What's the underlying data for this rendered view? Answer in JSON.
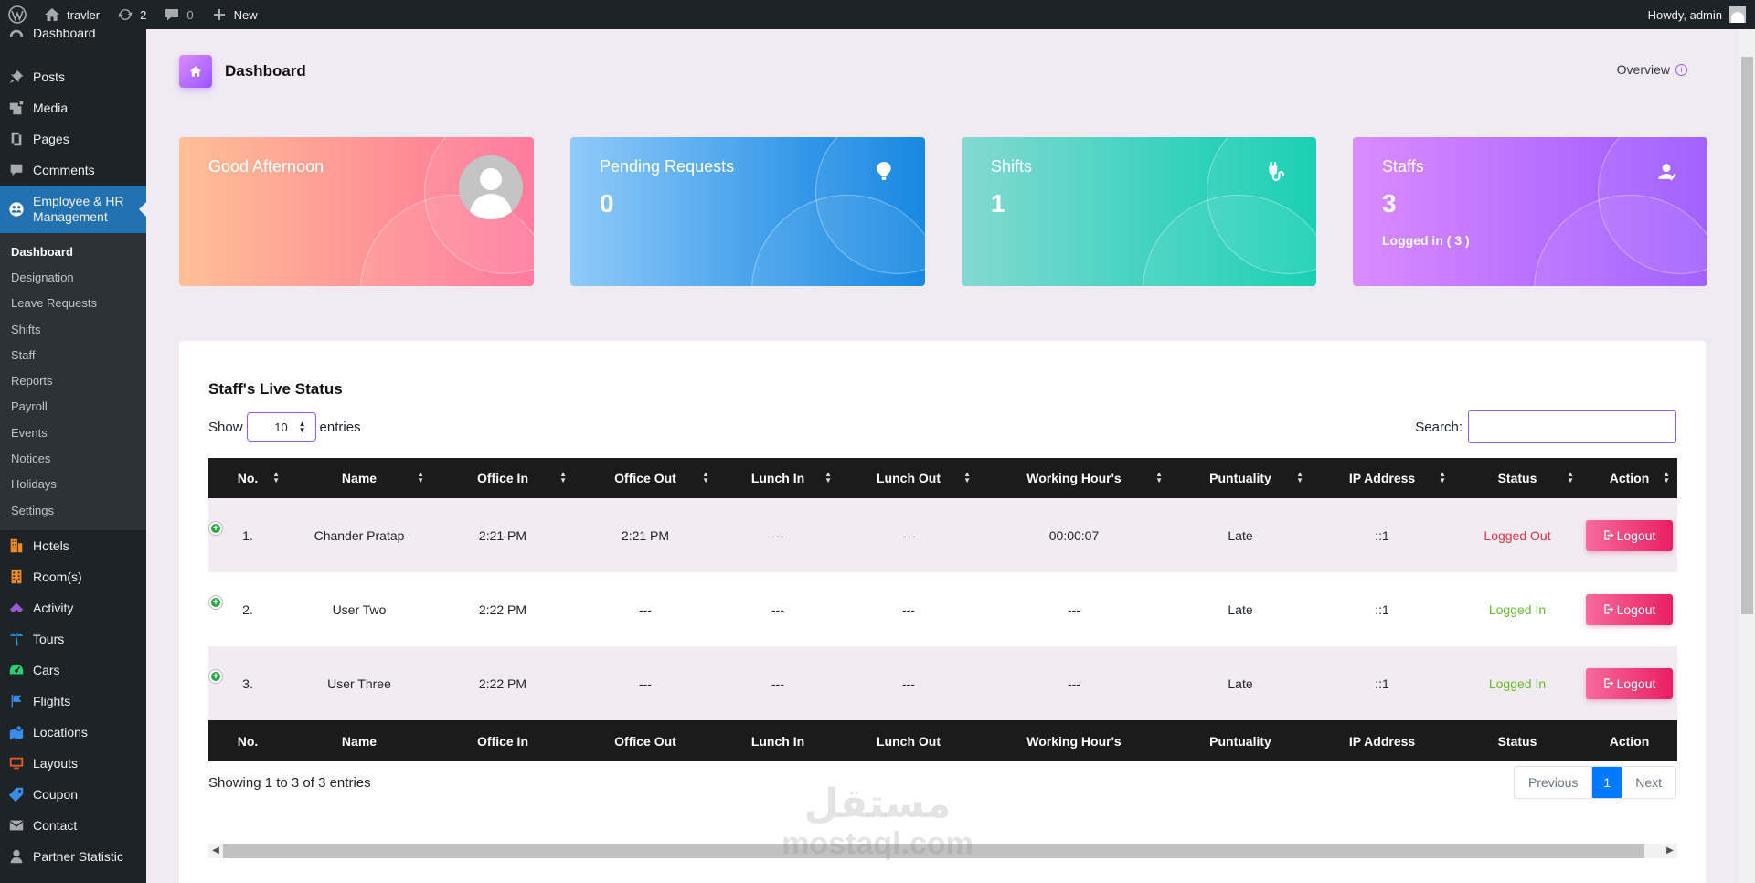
{
  "adminbar": {
    "site_name": "travler",
    "updates_count": "2",
    "comments_count": "0",
    "new_label": "New",
    "howdy": "Howdy, admin"
  },
  "sidebar": {
    "top_item": "Dashboard",
    "items_before": [
      "Posts",
      "Media",
      "Pages",
      "Comments"
    ],
    "current": "Employee & HR Management",
    "submenu": [
      "Dashboard",
      "Designation",
      "Leave Requests",
      "Shifts",
      "Staff",
      "Reports",
      "Payroll",
      "Events",
      "Notices",
      "Holidays",
      "Settings"
    ],
    "items_after": [
      "Hotels",
      "Room(s)",
      "Activity",
      "Tours",
      "Cars",
      "Flights",
      "Locations",
      "Layouts",
      "Coupon",
      "Contact",
      "Partner Statistic"
    ]
  },
  "header": {
    "title": "Dashboard",
    "overview": "Overview"
  },
  "cards": {
    "greeting": "Good Afternoon",
    "pending_title": "Pending Requests",
    "pending_value": "0",
    "shifts_title": "Shifts",
    "shifts_value": "1",
    "staffs_title": "Staffs",
    "staffs_value": "3",
    "staffs_sub": "Logged in ( 3 )"
  },
  "table": {
    "title": "Staff's Live Status",
    "show_label": "Show",
    "entries_value": "10",
    "entries_label": "entries",
    "search_label": "Search:",
    "headers": [
      "No.",
      "Name",
      "Office In",
      "Office Out",
      "Lunch In",
      "Lunch Out",
      "Working Hour's",
      "Puntuality",
      "IP Address",
      "Status",
      "Action"
    ],
    "rows": [
      [
        "1.",
        "Chander Pratap",
        "2:21 PM",
        "2:21 PM",
        "---",
        "---",
        "00:00:07",
        "Late",
        "::1",
        "Logged Out",
        "Logout"
      ],
      [
        "2.",
        "User Two",
        "2:22 PM",
        "---",
        "---",
        "---",
        "---",
        "Late",
        "::1",
        "Logged In",
        "Logout"
      ],
      [
        "3.",
        "User Three",
        "2:22 PM",
        "---",
        "---",
        "---",
        "---",
        "Late",
        "::1",
        "Logged In",
        "Logout"
      ]
    ],
    "showing": "Showing 1 to 3 of 3 entries",
    "pager": {
      "previous": "Previous",
      "current": "1",
      "next": "Next"
    }
  },
  "watermark": {
    "arabic": "مستقل",
    "latin": "mostaql.com"
  },
  "colors": {
    "accent": "#9a55ff",
    "wp_blue": "#2271b1",
    "logged_out": "#dc3545",
    "logged_in": "#66bb2a",
    "logout_btn": "#e91e63"
  }
}
